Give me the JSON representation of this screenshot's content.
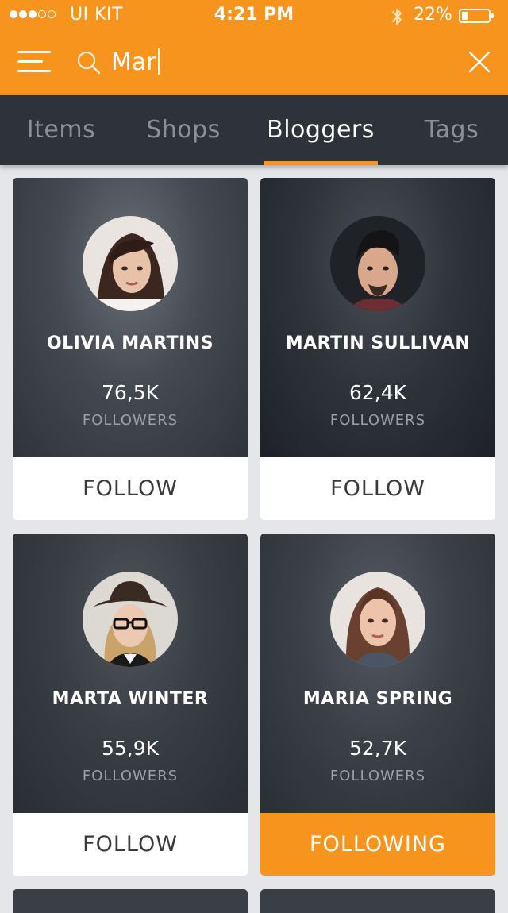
{
  "status_bar": {
    "signal_dots": [
      true,
      true,
      true,
      false,
      false
    ],
    "carrier": "UI KIT",
    "time": "4:21 PM",
    "bluetooth_icon": "bluetooth-icon",
    "battery_percent": "22%",
    "battery_level": 0.22
  },
  "search": {
    "menu_icon": "hamburger-menu-icon",
    "search_icon": "search-icon",
    "query": "Mar",
    "close_icon": "close-icon"
  },
  "tabs": [
    {
      "label": "Items",
      "active": false
    },
    {
      "label": "Shops",
      "active": false
    },
    {
      "label": "Bloggers",
      "active": true
    },
    {
      "label": "Tags",
      "active": false
    }
  ],
  "bloggers": [
    {
      "name": "OLIVIA MARTINS",
      "followers": "76,5K",
      "followers_label": "FOLLOWERS",
      "action": "FOLLOW",
      "following": false
    },
    {
      "name": "MARTIN SULLIVAN",
      "followers": "62,4K",
      "followers_label": "FOLLOWERS",
      "action": "FOLLOW",
      "following": false
    },
    {
      "name": "MARTA WINTER",
      "followers": "55,9K",
      "followers_label": "FOLLOWERS",
      "action": "FOLLOW",
      "following": false
    },
    {
      "name": "MARIA SPRING",
      "followers": "52,7K",
      "followers_label": "FOLLOWERS",
      "action": "FOLLOWING",
      "following": true
    }
  ],
  "colors": {
    "accent": "#f7941d",
    "tab_bar": "#2d323b",
    "background": "#e4e6ea"
  }
}
